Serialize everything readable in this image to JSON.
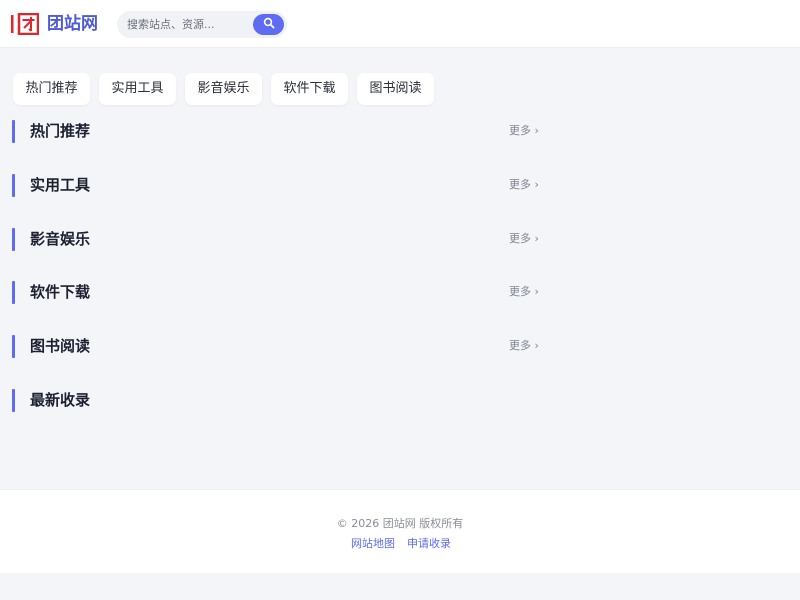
{
  "header": {
    "site_name": "团站网",
    "search_placeholder": "搜索站点、资源..."
  },
  "tabs": [
    {
      "label": "热门推荐"
    },
    {
      "label": "实用工具"
    },
    {
      "label": "影音娱乐"
    },
    {
      "label": "软件下载"
    },
    {
      "label": "图书阅读"
    }
  ],
  "sections": [
    {
      "title": "热门推荐",
      "more": "更多 ›"
    },
    {
      "title": "实用工具",
      "more": "更多 ›"
    },
    {
      "title": "影音娱乐",
      "more": "更多 ›"
    },
    {
      "title": "软件下载",
      "more": "更多 ›"
    },
    {
      "title": "图书阅读",
      "more": "更多 ›"
    },
    {
      "title": "最新收录"
    }
  ],
  "footer": {
    "copyright": "© 2026 团站网 版权所有",
    "links": [
      {
        "label": "网站地图"
      },
      {
        "label": "申请收录"
      }
    ]
  },
  "colors": {
    "accent": "#5f6bf2",
    "brand_text": "#4f5bd5",
    "logo_red": "#e0262b",
    "background": "#f4f5f9"
  }
}
